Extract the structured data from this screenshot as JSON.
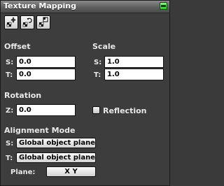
{
  "window": {
    "title": "Texture Mapping"
  },
  "toolbar": {
    "buttons": [
      {
        "icon": "move-icon"
      },
      {
        "icon": "rotate-icon"
      },
      {
        "icon": "scale-icon"
      }
    ]
  },
  "offset": {
    "heading": "Offset",
    "s_label": "S:",
    "s_value": "0.0",
    "t_label": "T:",
    "t_value": "0.0"
  },
  "scale": {
    "heading": "Scale",
    "s_label": "S:",
    "s_value": "1.0",
    "t_label": "T:",
    "t_value": "1.0"
  },
  "rotation": {
    "heading": "Rotation",
    "z_label": "Z:",
    "z_value": "0.0"
  },
  "reflection": {
    "label": "Reflection",
    "checked": false
  },
  "alignment": {
    "heading": "Alignment Mode",
    "s_label": "S:",
    "s_value": "Global object plane",
    "t_label": "T:",
    "t_value": "Global object plane",
    "plane_label": "Plane:",
    "plane_value": "X Y"
  },
  "colors": {
    "panel": "#3d3d3d",
    "title_accent": "#2dc42a"
  }
}
